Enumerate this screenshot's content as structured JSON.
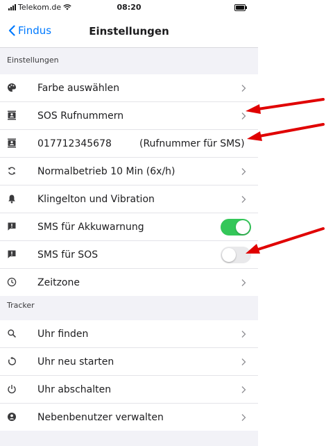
{
  "status_bar": {
    "carrier": "Telekom.de",
    "time": "08:20"
  },
  "nav": {
    "back_label": "Findus",
    "title": "Einstellungen"
  },
  "sections": {
    "settings": {
      "header": "Einstellungen",
      "items": [
        {
          "label": "Farbe auswählen",
          "icon": "palette-icon"
        },
        {
          "label": "SOS Rufnummern",
          "icon": "contacts-icon"
        },
        {
          "label": "017712345678",
          "value": "(Rufnummer für SMS)",
          "icon": "contacts-icon"
        },
        {
          "label": "Normalbetrieb 10 Min (6x/h)",
          "icon": "sync-icon"
        },
        {
          "label": "Klingelton und Vibration",
          "icon": "bell-icon"
        },
        {
          "label": "SMS für Akkuwarnung",
          "icon": "alert-message-icon",
          "toggle": true
        },
        {
          "label": "SMS für SOS",
          "icon": "alert-message-icon",
          "toggle": false
        },
        {
          "label": "Zeitzone",
          "icon": "clock-icon"
        }
      ]
    },
    "tracker": {
      "header": "Tracker",
      "items": [
        {
          "label": "Uhr finden",
          "icon": "search-icon"
        },
        {
          "label": "Uhr neu starten",
          "icon": "restart-icon"
        },
        {
          "label": "Uhr abschalten",
          "icon": "power-icon"
        },
        {
          "label": "Nebenbenutzer verwalten",
          "icon": "user-circle-icon"
        }
      ]
    }
  },
  "colors": {
    "accent": "#007aff",
    "toggle_on": "#34c759",
    "toggle_off": "#e9e9eb",
    "annotation_arrow": "#e00000",
    "background": "#f2f2f7"
  }
}
